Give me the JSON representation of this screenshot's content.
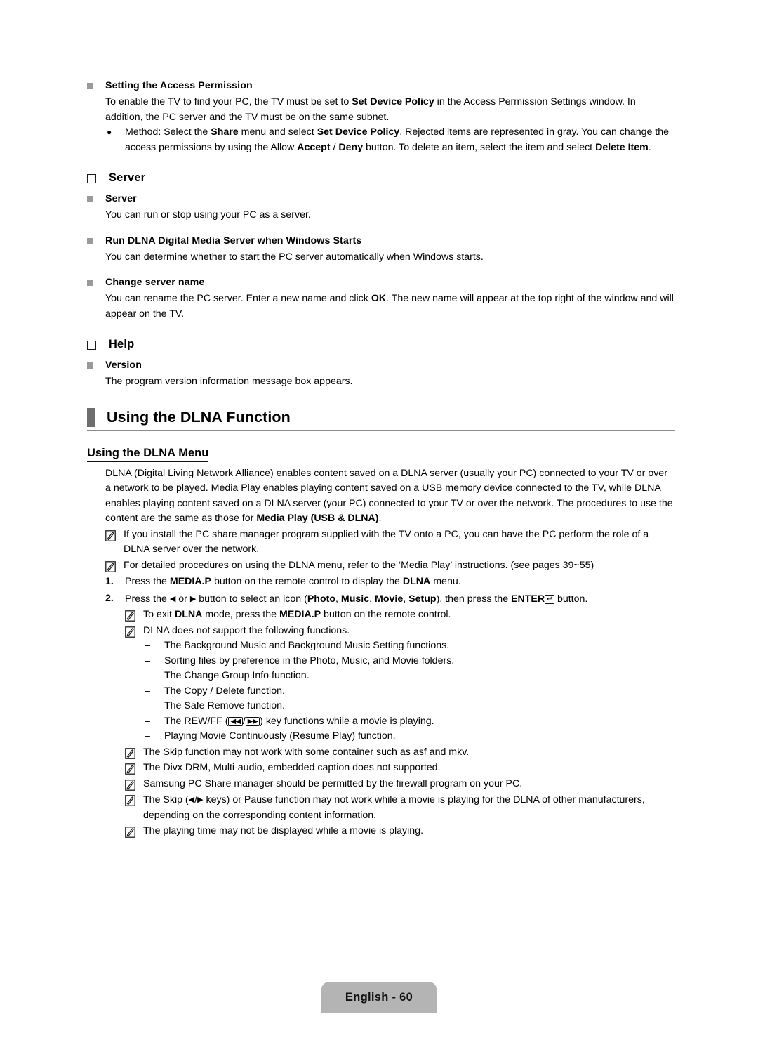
{
  "document": {
    "page_label": "English - 60"
  },
  "access_permission": {
    "heading": "Setting the Access Permission",
    "paragraph_1": "To enable the TV to find your PC, the TV must be set to ",
    "paragraph_1_b1": "Set Device Policy",
    "paragraph_1_cont": " in the Access Permission Settings window. In addition, the PC server and the TV must be on the same subnet.",
    "bullet_marker": "●",
    "bullet_1a": "Method: Select the ",
    "bullet_1b1": "Share",
    "bullet_1b": " menu and select ",
    "bullet_1b2": "Set Device Policy",
    "bullet_1c": ". Rejected items are represented in gray. You can change the access permissions by using the Allow ",
    "bullet_1b3": "Accept",
    "bullet_1d": " / ",
    "bullet_1b4": "Deny",
    "bullet_1e": " button. To delete an item, select the item and select ",
    "bullet_1b5": "Delete Item",
    "bullet_1f": "."
  },
  "server_section": {
    "heading": "Server",
    "items": [
      {
        "title": "Server",
        "body": "You can run or stop using your PC as a server."
      },
      {
        "title": "Run DLNA Digital Media Server when Windows Starts",
        "body": "You can determine whether to start the PC server automatically when Windows starts."
      },
      {
        "title": "Change server name",
        "body_a": "You can rename the PC server. Enter a new name and click ",
        "body_b": "OK",
        "body_c": ". The new name will appear at the top right of the window and will appear on the TV."
      }
    ]
  },
  "help_section": {
    "heading": "Help",
    "items": [
      {
        "title": "Version",
        "body": "The program version information message box appears."
      }
    ]
  },
  "dlna_section": {
    "banner_title": "Using the DLNA Function",
    "sub_heading": "Using the DLNA Menu",
    "intro_a": "DLNA (Digital Living Network Alliance) enables content saved on a DLNA server (usually your PC) connected to your TV or over a network to be played. Media Play enables playing content saved on a USB memory device connected to the TV, while DLNA enables playing content saved on a DLNA server (your PC) connected to your TV or over the network. The procedures to use the content are the same as those for ",
    "intro_b": "Media Play (USB & DLNA)",
    "intro_c": ".",
    "notes_top": [
      "If you install the PC share manager program supplied with the TV onto a PC, you can have the PC perform the role of a DLNA server over the network.",
      "For detailed procedures on using the DLNA menu, refer to the ‘Media Play’ instructions. (see pages 39~55)"
    ],
    "steps": [
      {
        "number": "1.",
        "a": "Press the ",
        "b1": "MEDIA.P",
        "c": " button on the remote control to display the ",
        "b2": "DLNA",
        "d": " menu."
      },
      {
        "number": "2.",
        "a": "Press the ",
        "left_arrow": "◀",
        "or": " or ",
        "right_arrow": "▶",
        "c": " button to select an icon (",
        "b1": "Photo",
        "sep1": ", ",
        "b2": "Music",
        "sep2": ", ",
        "b3": "Movie",
        "sep3": ", ",
        "b4": "Setup",
        "d": "), then press the ",
        "b5": "ENTER",
        "enter_glyph": "↵",
        "e": " button."
      }
    ],
    "step_notes": [
      {
        "a": "To exit ",
        "b1": "DLNA",
        "c": " mode, press the ",
        "b2": "MEDIA.P",
        "d": " button on the remote control."
      },
      {
        "a": "DLNA does not support the following functions.",
        "b1": "",
        "c": "",
        "b2": "",
        "d": ""
      }
    ],
    "unsupported": [
      "The Background Music and Background Music Setting functions.",
      "Sorting files by preference in the Photo, Music, and Movie folders.",
      "The Change Group Info function.",
      "The Copy / Delete function.",
      "The Safe Remove function.",
      "REWFF_SPECIAL",
      "Playing Movie Continuously (Resume Play) function."
    ],
    "rewff": {
      "a": "The REW/FF (",
      "rew_glyph": "◀◀",
      "slash": "/",
      "ff_glyph": "▶▶",
      "b": ") key functions while a movie is playing."
    },
    "notes_bottom": [
      "The Skip function may not work with some container such as asf and mkv.",
      "The Divx DRM, Multi-audio, embedded caption does not supported.",
      "Samsung PC Share manager should be permitted by the firewall program on your PC.",
      "SKIP_SPECIAL",
      "The playing time may not be displayed while a movie is playing."
    ],
    "skip_note": {
      "a": "The Skip (",
      "left_arrow": "◀",
      "slash": "/",
      "right_arrow": "▶",
      "b": " keys) or Pause function may not work while a movie is playing for the DLNA of other manufacturers, depending on the corresponding content information."
    },
    "dash_marker": "–"
  },
  "colors": {
    "square_marker": "#9a9a9a",
    "banner_bar": "#6e6e6e",
    "banner_rule": "#8c8c8c",
    "footer_bg": "#b4b4b4"
  }
}
